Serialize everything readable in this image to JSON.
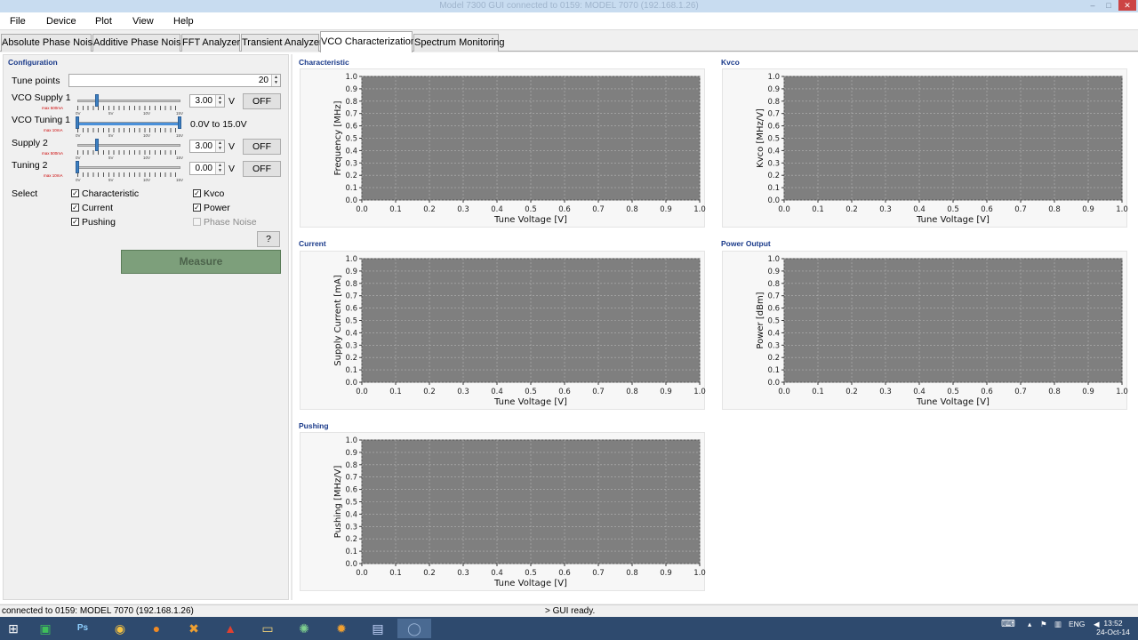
{
  "window": {
    "title": "Model 7300 GUI connected to 0159: MODEL 7070 (192.168.1.26)"
  },
  "menu": {
    "items": [
      "File",
      "Device",
      "Plot",
      "View",
      "Help"
    ]
  },
  "tabs": [
    {
      "label": "Absolute Phase Noise",
      "active": false
    },
    {
      "label": "Additive Phase Noise",
      "active": false
    },
    {
      "label": "FFT Analyzer",
      "active": false
    },
    {
      "label": "Transient Analyzer",
      "active": false
    },
    {
      "label": "VCO Characterization",
      "active": true
    },
    {
      "label": "Spectrum Monitoring",
      "active": false
    }
  ],
  "config": {
    "title": "Configuration",
    "tune_points_label": "Tune points",
    "tune_points_value": "20",
    "vco_supply_1": {
      "label": "VCO Supply 1",
      "value": "3.00",
      "unit": "V",
      "state": "OFF",
      "max_note": "max 500mA",
      "slider_fraction": 0.2
    },
    "vco_tuning_1": {
      "label": "VCO Tuning 1",
      "range_text": "0.0V to 15.0V",
      "max_note": "max 10mA",
      "range_fraction": [
        0.0,
        1.0
      ]
    },
    "supply_2": {
      "label": "Supply 2",
      "value": "3.00",
      "unit": "V",
      "state": "OFF",
      "max_note": "max 500mA",
      "slider_fraction": 0.2
    },
    "tuning_2": {
      "label": "Tuning 2",
      "value": "0.00",
      "unit": "V",
      "state": "OFF",
      "max_note": "max 10mA",
      "slider_fraction": 0.0
    },
    "slider_tick_labels": [
      "0V",
      "5V",
      "10V",
      "15V"
    ],
    "select_label": "Select",
    "checkboxes": [
      {
        "label": "Characteristic",
        "checked": true,
        "enabled": true
      },
      {
        "label": "Kvco",
        "checked": true,
        "enabled": true
      },
      {
        "label": "Current",
        "checked": true,
        "enabled": true
      },
      {
        "label": "Power",
        "checked": true,
        "enabled": true
      },
      {
        "label": "Pushing",
        "checked": true,
        "enabled": true
      },
      {
        "label": "Phase Noise",
        "checked": false,
        "enabled": false
      }
    ],
    "help_label": "?",
    "measure_label": "Measure"
  },
  "chart_data": [
    {
      "id": "characteristic",
      "type": "line",
      "title": "Characteristic",
      "xlabel": "Tune Voltage [V]",
      "ylabel": "Frequency [MHz]",
      "xlim": [
        0.0,
        1.0
      ],
      "ylim": [
        0.0,
        1.0
      ],
      "xticks": [
        "0.0",
        "0.1",
        "0.2",
        "0.3",
        "0.4",
        "0.5",
        "0.6",
        "0.7",
        "0.8",
        "0.9",
        "1.0"
      ],
      "yticks": [
        "0.0",
        "0.1",
        "0.2",
        "0.3",
        "0.4",
        "0.5",
        "0.6",
        "0.7",
        "0.8",
        "0.9",
        "1.0"
      ],
      "grid": true,
      "series": []
    },
    {
      "id": "kvco",
      "type": "line",
      "title": "Kvco",
      "xlabel": "Tune Voltage [V]",
      "ylabel": "Kvco [MHz/V]",
      "xlim": [
        0.0,
        1.0
      ],
      "ylim": [
        0.0,
        1.0
      ],
      "xticks": [
        "0.0",
        "0.1",
        "0.2",
        "0.3",
        "0.4",
        "0.5",
        "0.6",
        "0.7",
        "0.8",
        "0.9",
        "1.0"
      ],
      "yticks": [
        "0.0",
        "0.1",
        "0.2",
        "0.3",
        "0.4",
        "0.5",
        "0.6",
        "0.7",
        "0.8",
        "0.9",
        "1.0"
      ],
      "grid": true,
      "series": []
    },
    {
      "id": "current",
      "type": "line",
      "title": "Current",
      "xlabel": "Tune Voltage [V]",
      "ylabel": "Supply Current [mA]",
      "xlim": [
        0.0,
        1.0
      ],
      "ylim": [
        0.0,
        1.0
      ],
      "xticks": [
        "0.0",
        "0.1",
        "0.2",
        "0.3",
        "0.4",
        "0.5",
        "0.6",
        "0.7",
        "0.8",
        "0.9",
        "1.0"
      ],
      "yticks": [
        "0.0",
        "0.1",
        "0.2",
        "0.3",
        "0.4",
        "0.5",
        "0.6",
        "0.7",
        "0.8",
        "0.9",
        "1.0"
      ],
      "grid": true,
      "series": []
    },
    {
      "id": "power",
      "type": "line",
      "title": "Power Output",
      "xlabel": "Tune Voltage [V]",
      "ylabel": "Power [dBm]",
      "xlim": [
        0.0,
        1.0
      ],
      "ylim": [
        0.0,
        1.0
      ],
      "xticks": [
        "0.0",
        "0.1",
        "0.2",
        "0.3",
        "0.4",
        "0.5",
        "0.6",
        "0.7",
        "0.8",
        "0.9",
        "1.0"
      ],
      "yticks": [
        "0.0",
        "0.1",
        "0.2",
        "0.3",
        "0.4",
        "0.5",
        "0.6",
        "0.7",
        "0.8",
        "0.9",
        "1.0"
      ],
      "grid": true,
      "series": []
    },
    {
      "id": "pushing",
      "type": "line",
      "title": "Pushing",
      "xlabel": "Tune Voltage [V]",
      "ylabel": "Pushing [MHz/V]",
      "xlim": [
        0.0,
        1.0
      ],
      "ylim": [
        0.0,
        1.0
      ],
      "xticks": [
        "0.0",
        "0.1",
        "0.2",
        "0.3",
        "0.4",
        "0.5",
        "0.6",
        "0.7",
        "0.8",
        "0.9",
        "1.0"
      ],
      "yticks": [
        "0.0",
        "0.1",
        "0.2",
        "0.3",
        "0.4",
        "0.5",
        "0.6",
        "0.7",
        "0.8",
        "0.9",
        "1.0"
      ],
      "grid": true,
      "series": []
    }
  ],
  "colors": {
    "plot_background": "#7f7f7f",
    "grid": "#b4b4b4",
    "section_title": "#1a3a8a",
    "measure_button": "#7d9f7b"
  },
  "status": {
    "left": "connected to 0159: MODEL 7070 (192.168.1.26)",
    "right": "> GUI ready."
  },
  "taskbar": {
    "icons": [
      "windows-start-icon",
      "excel-icon",
      "photoshop-icon",
      "chrome-icon",
      "firefox-icon",
      "xampp-icon",
      "filezilla-icon",
      "file-explorer-icon",
      "network-icon",
      "settings-icon",
      "floppy-icon",
      "app-icon"
    ],
    "ps_label": "Ps",
    "language": "ENG",
    "time": "13:52",
    "date": "24-Oct-14"
  }
}
